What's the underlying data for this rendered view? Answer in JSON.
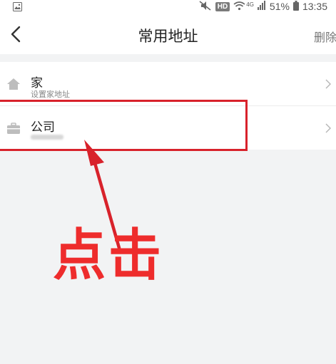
{
  "status_bar": {
    "hd_label": "HD",
    "network_label": "4G",
    "battery_percent": "51%",
    "time": "13:35"
  },
  "header": {
    "title": "常用地址",
    "delete_label": "删除"
  },
  "addresses": [
    {
      "icon": "home-icon",
      "title": "家",
      "subtitle": "设置家地址"
    },
    {
      "icon": "briefcase-icon",
      "title": "公司",
      "subtitle": ""
    }
  ],
  "annotation": {
    "text": "点击",
    "color": "#ee2c2c"
  },
  "colors": {
    "highlight": "#d8222b",
    "background": "#f2f3f4"
  }
}
